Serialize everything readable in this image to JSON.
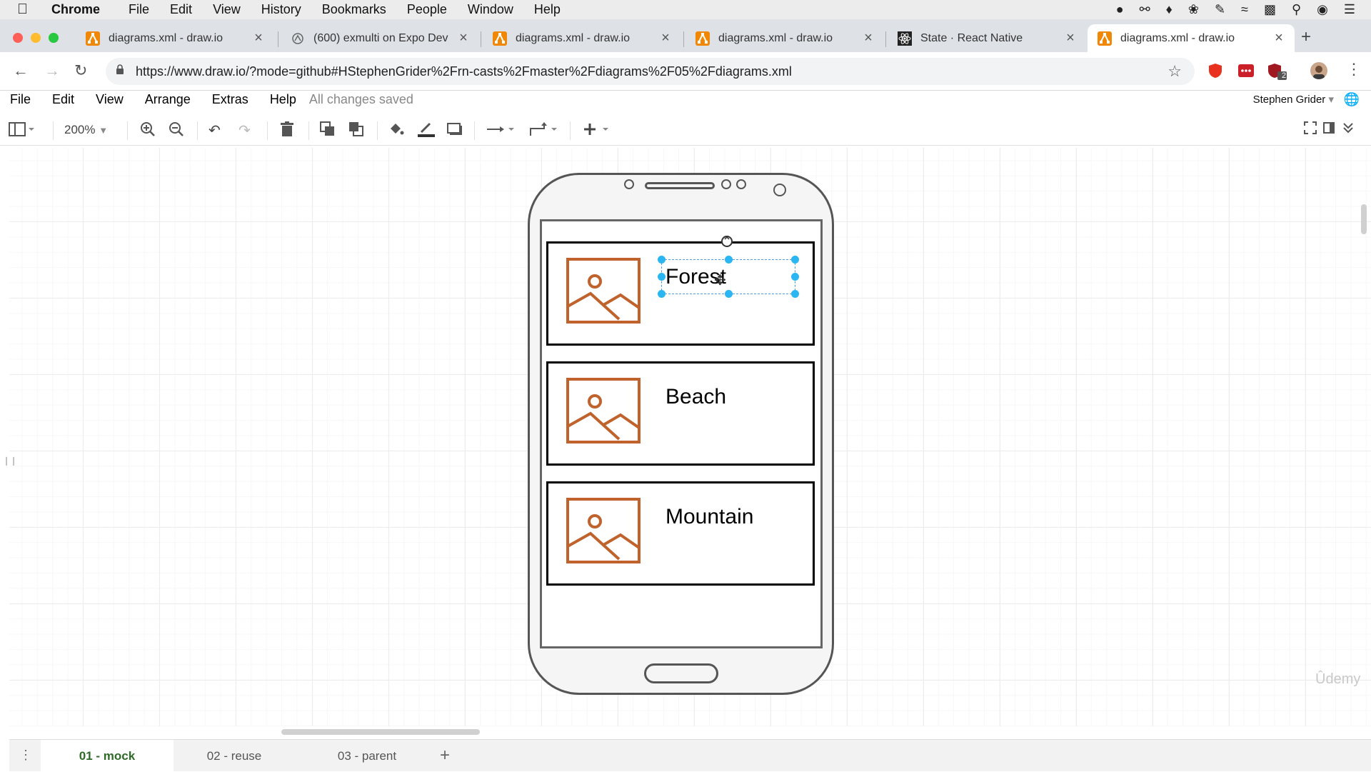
{
  "mac_menu": {
    "app_name": "Chrome",
    "items": [
      "File",
      "Edit",
      "View",
      "History",
      "Bookmarks",
      "People",
      "Window",
      "Help"
    ]
  },
  "tabs": [
    {
      "title": "diagrams.xml - draw.io",
      "icon": "drawio-icon",
      "active": false
    },
    {
      "title": "(600) exmulti on Expo Dev",
      "icon": "expo-icon",
      "active": false
    },
    {
      "title": "diagrams.xml - draw.io",
      "icon": "drawio-icon",
      "active": false
    },
    {
      "title": "diagrams.xml - draw.io",
      "icon": "drawio-icon",
      "active": false
    },
    {
      "title": "State · React Native",
      "icon": "react-icon",
      "active": false
    },
    {
      "title": "diagrams.xml - draw.io",
      "icon": "drawio-icon",
      "active": true
    }
  ],
  "address": {
    "url": "https://www.draw.io/?mode=github#HStephenGrider%2Frn-casts%2Fmaster%2Fdiagrams%2F05%2Fdiagrams.xml",
    "extension_badge": "2"
  },
  "app_menu": {
    "items": [
      "File",
      "Edit",
      "View",
      "Arrange",
      "Extras",
      "Help"
    ],
    "status": "All changes saved",
    "user": "Stephen Grider"
  },
  "toolbar": {
    "zoom": "200%"
  },
  "mock": {
    "cards": [
      {
        "label": "Forest",
        "selected": true
      },
      {
        "label": "Beach",
        "selected": false
      },
      {
        "label": "Mountain",
        "selected": false
      }
    ],
    "image_color": "#c0622b"
  },
  "watermark": "Ûdemy",
  "pages": [
    {
      "label": "01 - mock",
      "active": true
    },
    {
      "label": "02 - reuse",
      "active": false
    },
    {
      "label": "03 - parent",
      "active": false
    }
  ],
  "colors": {
    "accent": "#29b6f2",
    "active_page": "#2e6b26",
    "drawio_orange": "#f08705"
  }
}
